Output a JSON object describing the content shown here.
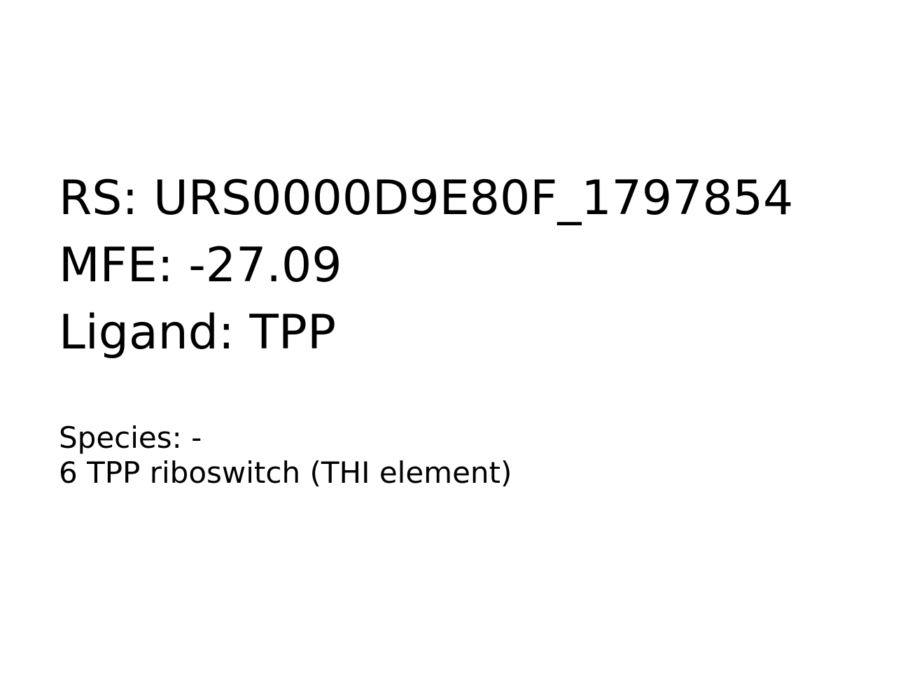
{
  "info": {
    "rs": "RS: URS0000D9E80F_1797854",
    "mfe": "MFE: -27.09",
    "ligand": "Ligand: TPP",
    "species": "Species: -",
    "description": "6 TPP riboswitch (THI element)"
  },
  "colors": {
    "background": "#ffffff",
    "text": "#000000"
  }
}
